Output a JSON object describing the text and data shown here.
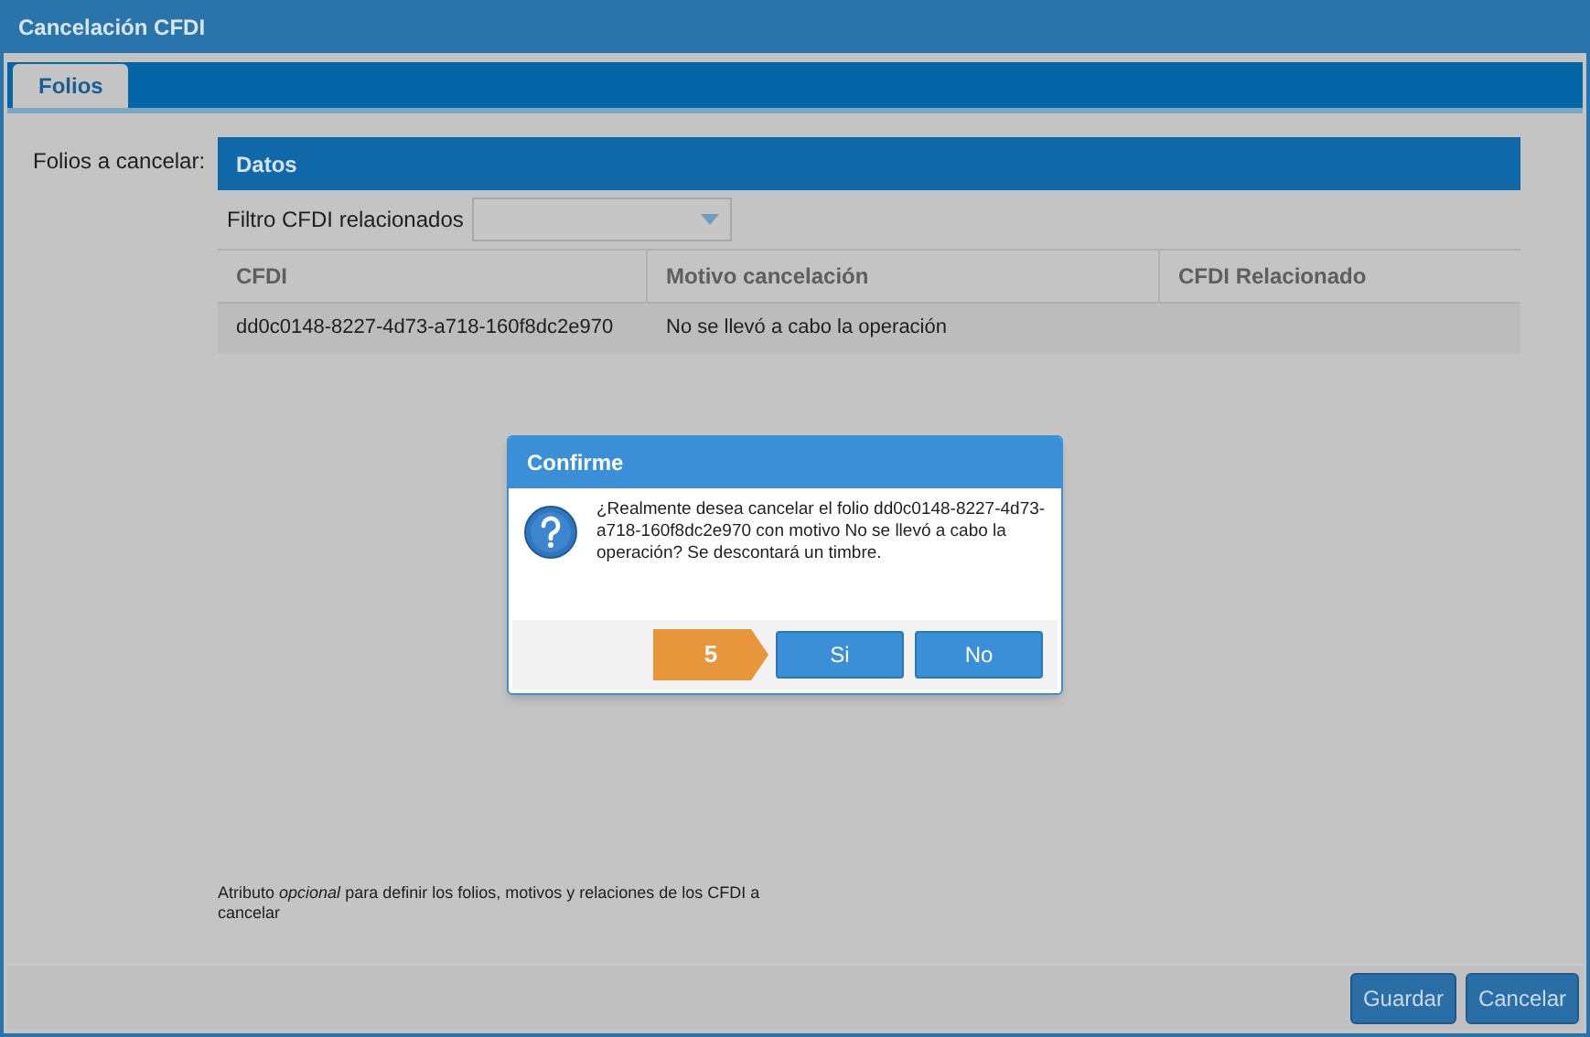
{
  "window": {
    "title": "Cancelación CFDI"
  },
  "tabs": [
    {
      "label": "Folios",
      "selected": true
    }
  ],
  "form": {
    "label": "Folios a cancelar:",
    "panel": {
      "title": "Datos",
      "filter": {
        "label": "Filtro CFDI relacionados"
      },
      "table": {
        "columns": [
          "CFDI",
          "Motivo cancelación",
          "CFDI Relacionado"
        ],
        "rows": [
          [
            "dd0c0148-8227-4d73-a718-160f8dc2e970",
            "No se llevó a cabo la operación",
            ""
          ]
        ]
      }
    },
    "help": "Atributo *opcional* para definir los folios, motivos y relaciones de los CFDI a cancelar"
  },
  "buttons": [
    "Guardar",
    "Cancelar"
  ],
  "dialog": {
    "title": "Confirme",
    "message": "¿Realmente desea cancelar el folio dd0c0148-8227-4d73-a718-160f8dc2e970 con motivo No se llevó a cabo la operación? Se descontará un timbre.",
    "step": "5",
    "buttons": [
      "Si",
      "No"
    ]
  }
}
